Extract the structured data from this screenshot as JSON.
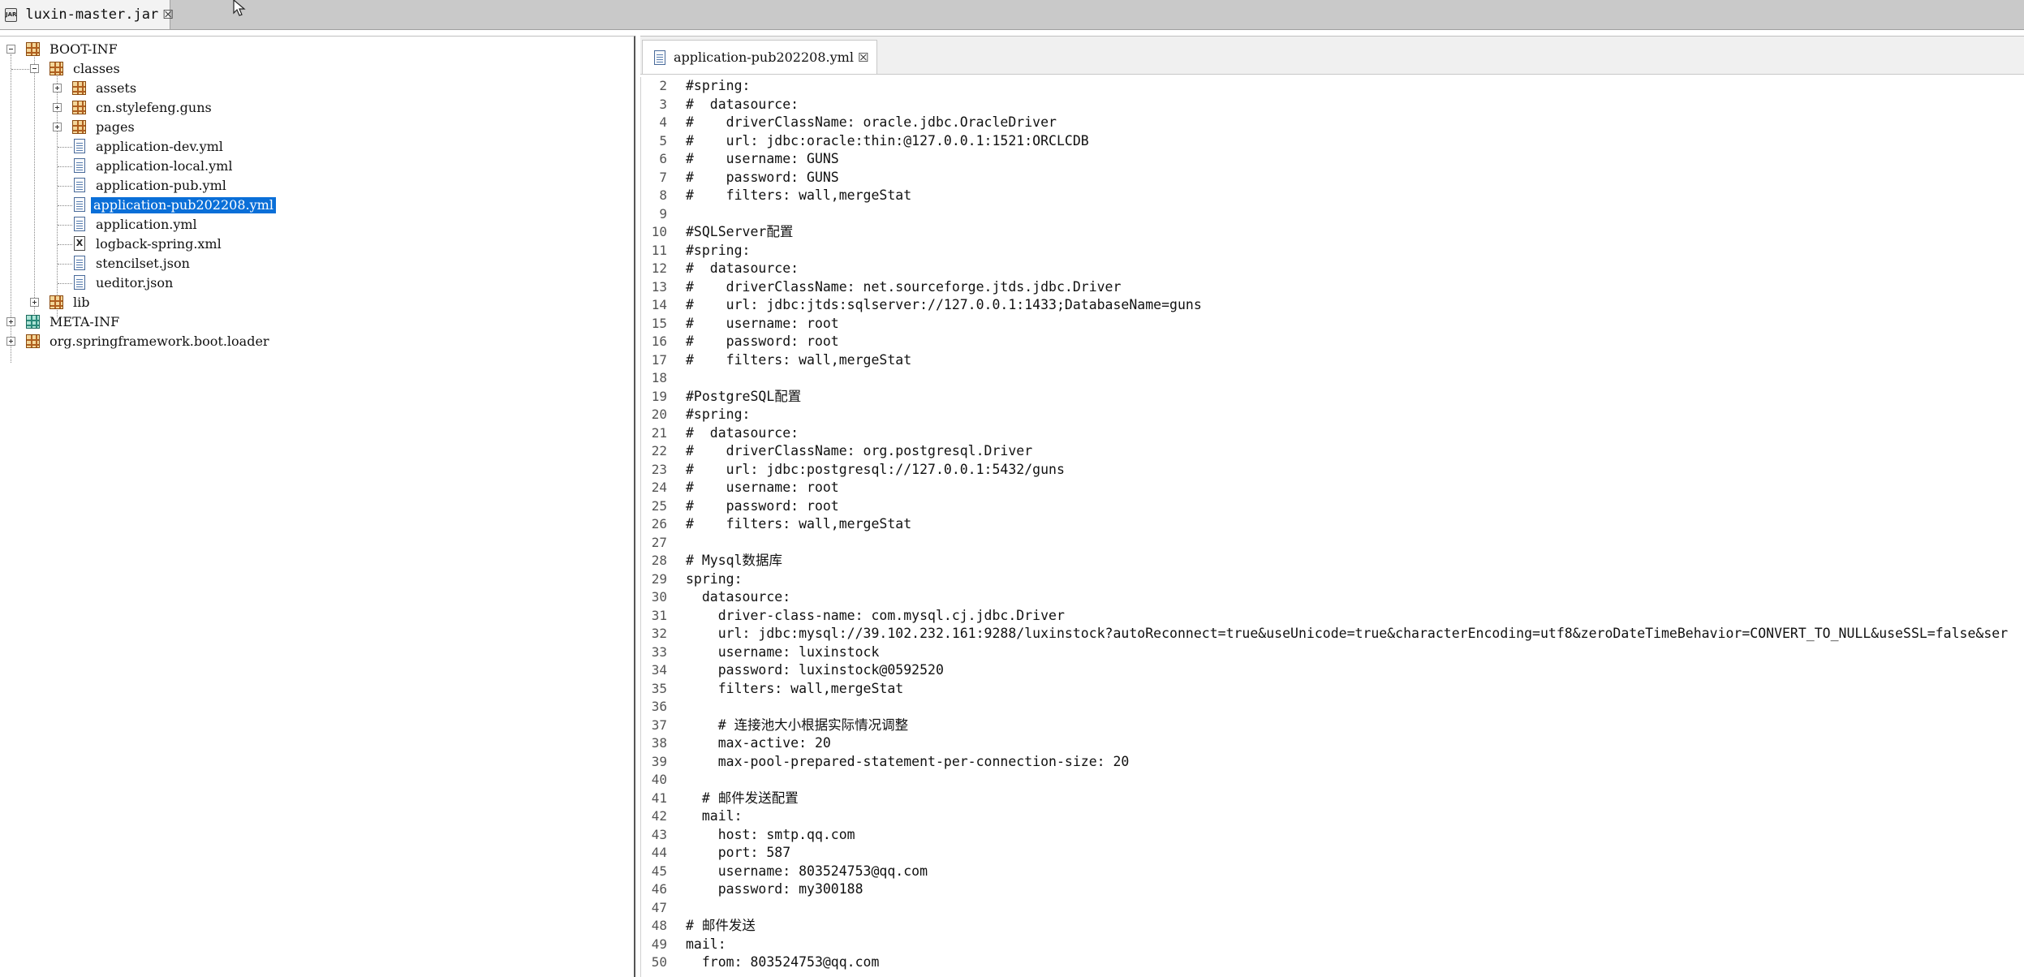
{
  "top_tab": {
    "label": "luxin-master.jar",
    "icon": "jar-icon",
    "icon_text": "JAR"
  },
  "tree": {
    "items": [
      {
        "label": "BOOT-INF",
        "icon": "package-icon"
      },
      {
        "label": "classes",
        "icon": "package-icon"
      },
      {
        "label": "assets",
        "icon": "package-icon"
      },
      {
        "label": "cn.stylefeng.guns",
        "icon": "package-icon"
      },
      {
        "label": "pages",
        "icon": "package-icon"
      },
      {
        "label": "application-dev.yml",
        "icon": "file-icon"
      },
      {
        "label": "application-local.yml",
        "icon": "file-icon"
      },
      {
        "label": "application-pub.yml",
        "icon": "file-icon"
      },
      {
        "label": "application-pub202208.yml",
        "icon": "file-icon",
        "selected": true
      },
      {
        "label": "application.yml",
        "icon": "file-icon"
      },
      {
        "label": "logback-spring.xml",
        "icon": "xml-file-icon",
        "icon_text": "X"
      },
      {
        "label": "stencilset.json",
        "icon": "file-icon"
      },
      {
        "label": "ueditor.json",
        "icon": "file-icon"
      },
      {
        "label": "lib",
        "icon": "package-icon"
      },
      {
        "label": "META-INF",
        "icon": "package-icon"
      },
      {
        "label": "org.springframework.boot.loader",
        "icon": "package-icon"
      }
    ]
  },
  "editor": {
    "tab_label": "application-pub202208.yml",
    "lines": [
      {
        "n": "2",
        "t": "#spring:"
      },
      {
        "n": "3",
        "t": "#  datasource:"
      },
      {
        "n": "4",
        "t": "#    driverClassName: oracle.jdbc.OracleDriver"
      },
      {
        "n": "5",
        "t": "#    url: jdbc:oracle:thin:@127.0.0.1:1521:ORCLCDB"
      },
      {
        "n": "6",
        "t": "#    username: GUNS"
      },
      {
        "n": "7",
        "t": "#    password: GUNS"
      },
      {
        "n": "8",
        "t": "#    filters: wall,mergeStat"
      },
      {
        "n": "9",
        "t": ""
      },
      {
        "n": "10",
        "t": "#SQLServer配置"
      },
      {
        "n": "11",
        "t": "#spring:"
      },
      {
        "n": "12",
        "t": "#  datasource:"
      },
      {
        "n": "13",
        "t": "#    driverClassName: net.sourceforge.jtds.jdbc.Driver"
      },
      {
        "n": "14",
        "t": "#    url: jdbc:jtds:sqlserver://127.0.0.1:1433;DatabaseName=guns"
      },
      {
        "n": "15",
        "t": "#    username: root"
      },
      {
        "n": "16",
        "t": "#    password: root"
      },
      {
        "n": "17",
        "t": "#    filters: wall,mergeStat"
      },
      {
        "n": "18",
        "t": ""
      },
      {
        "n": "19",
        "t": "#PostgreSQL配置"
      },
      {
        "n": "20",
        "t": "#spring:"
      },
      {
        "n": "21",
        "t": "#  datasource:"
      },
      {
        "n": "22",
        "t": "#    driverClassName: org.postgresql.Driver"
      },
      {
        "n": "23",
        "t": "#    url: jdbc:postgresql://127.0.0.1:5432/guns"
      },
      {
        "n": "24",
        "t": "#    username: root"
      },
      {
        "n": "25",
        "t": "#    password: root"
      },
      {
        "n": "26",
        "t": "#    filters: wall,mergeStat"
      },
      {
        "n": "27",
        "t": ""
      },
      {
        "n": "28",
        "t": "# Mysql数据库"
      },
      {
        "n": "29",
        "t": "spring:"
      },
      {
        "n": "30",
        "t": "  datasource:"
      },
      {
        "n": "31",
        "t": "    driver-class-name: com.mysql.cj.jdbc.Driver"
      },
      {
        "n": "32",
        "t": "    url: jdbc:mysql://39.102.232.161:9288/luxinstock?autoReconnect=true&useUnicode=true&characterEncoding=utf8&zeroDateTimeBehavior=CONVERT_TO_NULL&useSSL=false&ser"
      },
      {
        "n": "33",
        "t": "    username: luxinstock"
      },
      {
        "n": "34",
        "t": "    password: luxinstock@0592520"
      },
      {
        "n": "35",
        "t": "    filters: wall,mergeStat"
      },
      {
        "n": "36",
        "t": ""
      },
      {
        "n": "37",
        "t": "    # 连接池大小根据实际情况调整"
      },
      {
        "n": "38",
        "t": "    max-active: 20"
      },
      {
        "n": "39",
        "t": "    max-pool-prepared-statement-per-connection-size: 20"
      },
      {
        "n": "40",
        "t": ""
      },
      {
        "n": "41",
        "t": "  # 邮件发送配置"
      },
      {
        "n": "42",
        "t": "  mail:"
      },
      {
        "n": "43",
        "t": "    host: smtp.qq.com"
      },
      {
        "n": "44",
        "t": "    port: 587"
      },
      {
        "n": "45",
        "t": "    username: 803524753@qq.com"
      },
      {
        "n": "46",
        "t": "    password: my300188"
      },
      {
        "n": "47",
        "t": ""
      },
      {
        "n": "48",
        "t": "# 邮件发送"
      },
      {
        "n": "49",
        "t": "mail:"
      },
      {
        "n": "50",
        "t": "  from: 803524753@qq.com"
      }
    ]
  }
}
